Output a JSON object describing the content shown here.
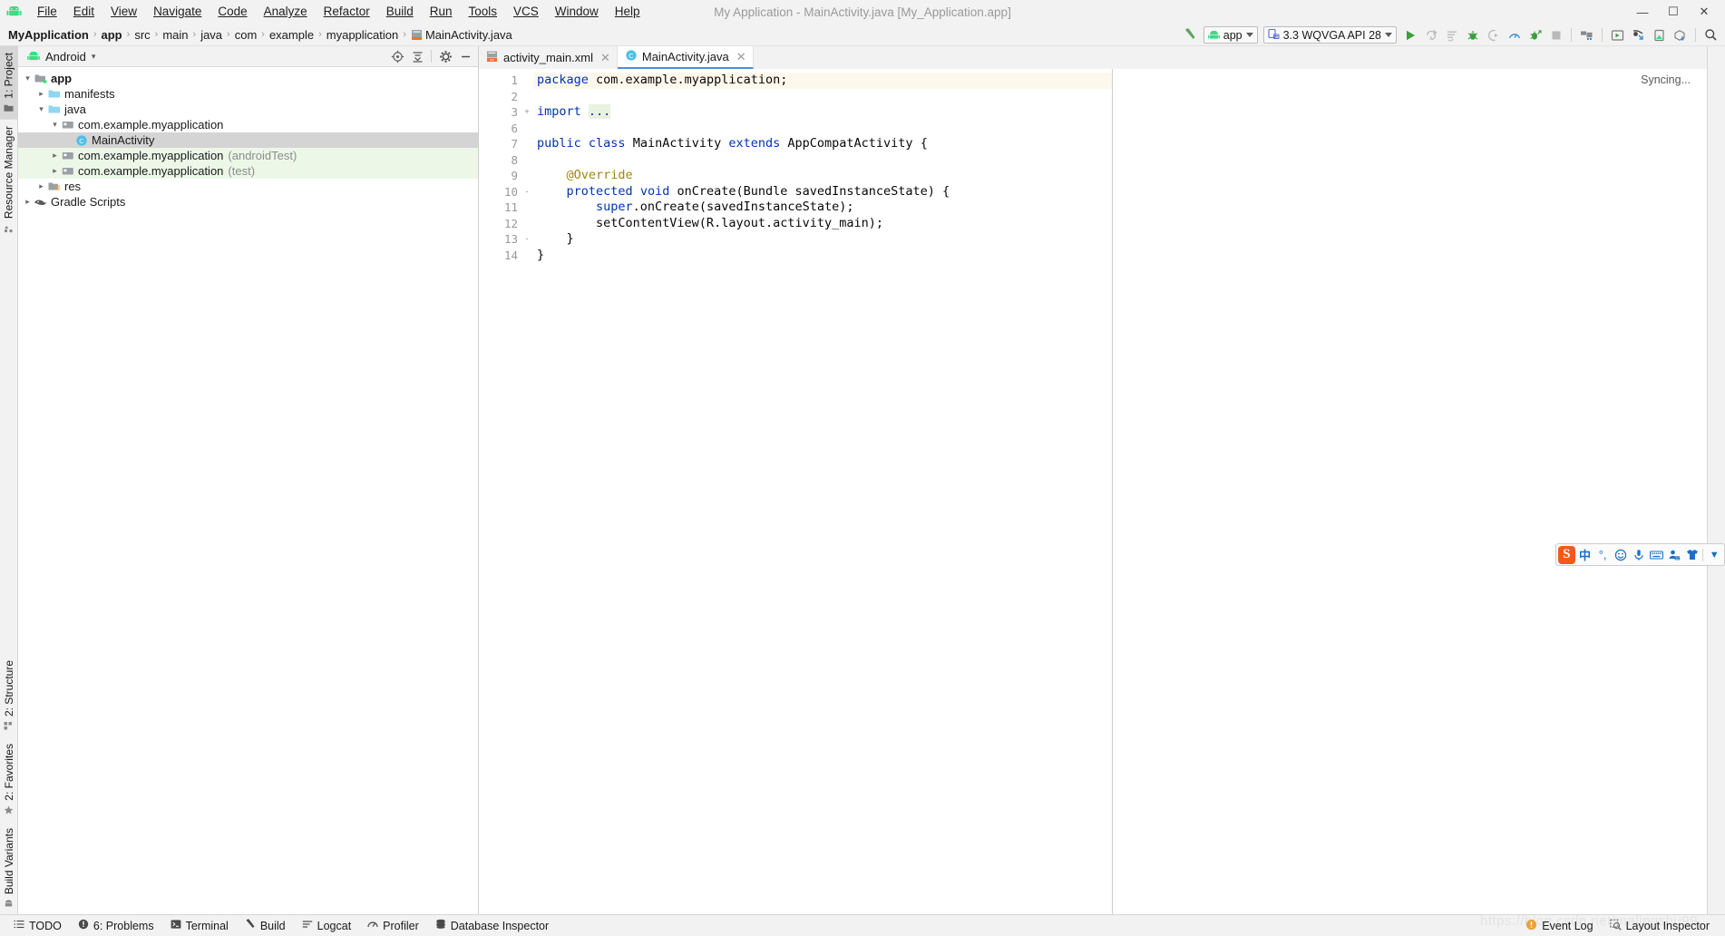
{
  "window": {
    "title": "My Application - MainActivity.java [My_Application.app]",
    "minimize": "—",
    "maximize": "☐",
    "close": "✕"
  },
  "menu": {
    "logo_icon": "android-logo-icon",
    "items": [
      {
        "label": "File"
      },
      {
        "label": "Edit"
      },
      {
        "label": "View"
      },
      {
        "label": "Navigate"
      },
      {
        "label": "Code"
      },
      {
        "label": "Analyze"
      },
      {
        "label": "Refactor"
      },
      {
        "label": "Build"
      },
      {
        "label": "Run"
      },
      {
        "label": "Tools"
      },
      {
        "label": "VCS"
      },
      {
        "label": "Window"
      },
      {
        "label": "Help"
      }
    ]
  },
  "breadcrumb": {
    "separator": "›",
    "items": [
      {
        "label": "MyApplication",
        "bold": true
      },
      {
        "label": "app",
        "bold": true
      },
      {
        "label": "src",
        "bold": false
      },
      {
        "label": "main",
        "bold": false
      },
      {
        "label": "java",
        "bold": false
      },
      {
        "label": "com",
        "bold": false
      },
      {
        "label": "example",
        "bold": false
      },
      {
        "label": "myapplication",
        "bold": false
      },
      {
        "label": "MainActivity.java",
        "bold": false,
        "icon": "java-file-icon"
      }
    ]
  },
  "toolbar": {
    "build_hammer_icon": "hammer-icon",
    "run_config": {
      "label": "app",
      "icon": "android-head-icon"
    },
    "device": {
      "label": "3.3  WQVGA API 28",
      "icon": "device-icon"
    },
    "actions": [
      {
        "name": "run-button",
        "icon": "play-icon",
        "enabled": true
      },
      {
        "name": "apply-changes-button",
        "icon": "apply-changes-icon",
        "enabled": false
      },
      {
        "name": "apply-code-changes-button",
        "icon": "apply-code-changes-icon",
        "enabled": false
      },
      {
        "name": "debug-button",
        "icon": "bug-icon",
        "enabled": true
      },
      {
        "name": "attach-debugger-button",
        "icon": "attach-debugger-icon",
        "enabled": false
      },
      {
        "name": "profile-button",
        "icon": "profiler-icon",
        "enabled": true
      },
      {
        "name": "run-with-coverage-button",
        "icon": "coverage-icon",
        "enabled": true
      },
      {
        "name": "stop-button",
        "icon": "stop-icon",
        "enabled": false
      }
    ],
    "actions2": [
      {
        "name": "sdk-manager-button",
        "icon": "sdk-manager-icon"
      },
      {
        "name": "avd-manager-button",
        "icon": "avd-manager-icon"
      },
      {
        "name": "device-file-explorer-button",
        "icon": "device-explorer-icon"
      },
      {
        "name": "layout-inspector-button",
        "icon": "layout-inspector-icon"
      },
      {
        "name": "gradle-sync-button",
        "icon": "gradle-sync-icon"
      },
      {
        "name": "search-everywhere-button",
        "icon": "search-icon"
      }
    ]
  },
  "left_strip": {
    "top": [
      {
        "label": "1: Project",
        "icon": "project-icon",
        "active": true
      },
      {
        "label": "Resource Manager",
        "icon": "resource-manager-icon",
        "active": false
      }
    ],
    "bottom": [
      {
        "label": "2: Structure",
        "icon": "structure-icon"
      },
      {
        "label": "2: Favorites",
        "icon": "star-icon"
      },
      {
        "label": "Build Variants",
        "icon": "build-variants-icon"
      }
    ]
  },
  "project_panel": {
    "title": "Android",
    "title_icon": "android-head-icon",
    "title_caret": "▾",
    "actions": [
      {
        "name": "select-opened-file-button",
        "icon": "target-icon"
      },
      {
        "name": "collapse-all-button",
        "icon": "collapse-all-icon"
      },
      {
        "name": "settings-button",
        "icon": "gear-icon"
      },
      {
        "name": "hide-button",
        "icon": "minimize-icon"
      }
    ],
    "tree": [
      {
        "label": "app",
        "suffix": "",
        "depth": 0,
        "arrow": "expanded",
        "icon": "module-icon",
        "bold": true,
        "state": "normal"
      },
      {
        "label": "manifests",
        "suffix": "",
        "depth": 1,
        "arrow": "collapsed",
        "icon": "folder-icon",
        "bold": false,
        "state": "normal"
      },
      {
        "label": "java",
        "suffix": "",
        "depth": 1,
        "arrow": "expanded",
        "icon": "folder-icon",
        "bold": false,
        "state": "normal"
      },
      {
        "label": "com.example.myapplication",
        "suffix": "",
        "depth": 2,
        "arrow": "expanded",
        "icon": "package-icon",
        "bold": false,
        "state": "normal"
      },
      {
        "label": "MainActivity",
        "suffix": "",
        "depth": 3,
        "arrow": "none",
        "icon": "class-icon",
        "bold": false,
        "state": "selected"
      },
      {
        "label": "com.example.myapplication",
        "suffix": "(androidTest)",
        "depth": 2,
        "arrow": "collapsed",
        "icon": "package-icon",
        "bold": false,
        "state": "green"
      },
      {
        "label": "com.example.myapplication",
        "suffix": "(test)",
        "depth": 2,
        "arrow": "collapsed",
        "icon": "package-icon",
        "bold": false,
        "state": "green"
      },
      {
        "label": "res",
        "suffix": "",
        "depth": 1,
        "arrow": "collapsed",
        "icon": "res-folder-icon",
        "bold": false,
        "state": "normal"
      },
      {
        "label": "Gradle Scripts",
        "suffix": "",
        "depth": 0,
        "arrow": "collapsed",
        "icon": "gradle-icon",
        "bold": false,
        "state": "normal"
      }
    ]
  },
  "editor": {
    "tabs": [
      {
        "label": "activity_main.xml",
        "icon": "xml-layout-icon",
        "active": false,
        "close": "✕"
      },
      {
        "label": "MainActivity.java",
        "icon": "class-icon",
        "active": true,
        "close": "✕"
      }
    ],
    "status_right": "Syncing...",
    "line_numbers": [
      "1",
      "2",
      "3",
      "6",
      "7",
      "8",
      "9",
      "10",
      "11",
      "12",
      "13",
      "14"
    ],
    "fold_marks": [
      "",
      "",
      "+",
      "",
      "",
      "",
      "",
      "-",
      "",
      "",
      "-",
      ""
    ],
    "lines": [
      {
        "num": "1",
        "highlight": true,
        "tokens": [
          {
            "t": "kw",
            "v": "package"
          },
          {
            "t": "plain",
            "v": " com.example.myapplication;"
          }
        ]
      },
      {
        "num": "2",
        "highlight": false,
        "tokens": []
      },
      {
        "num": "3",
        "highlight": false,
        "tokens": [
          {
            "t": "kw",
            "v": "import"
          },
          {
            "t": "plain",
            "v": " "
          },
          {
            "t": "fold",
            "v": "..."
          }
        ]
      },
      {
        "num": "6",
        "highlight": false,
        "tokens": []
      },
      {
        "num": "7",
        "highlight": false,
        "tokens": [
          {
            "t": "kw",
            "v": "public"
          },
          {
            "t": "plain",
            "v": " "
          },
          {
            "t": "kw",
            "v": "class"
          },
          {
            "t": "plain",
            "v": " MainActivity "
          },
          {
            "t": "kw",
            "v": "extends"
          },
          {
            "t": "plain",
            "v": " AppCompatActivity {"
          }
        ]
      },
      {
        "num": "8",
        "highlight": false,
        "tokens": []
      },
      {
        "num": "9",
        "highlight": false,
        "tokens": [
          {
            "t": "plain",
            "v": "    "
          },
          {
            "t": "an",
            "v": "@Override"
          }
        ]
      },
      {
        "num": "10",
        "highlight": false,
        "tokens": [
          {
            "t": "plain",
            "v": "    "
          },
          {
            "t": "kw",
            "v": "protected"
          },
          {
            "t": "plain",
            "v": " "
          },
          {
            "t": "kw",
            "v": "void"
          },
          {
            "t": "plain",
            "v": " onCreate(Bundle savedInstanceState) {"
          }
        ]
      },
      {
        "num": "11",
        "highlight": false,
        "tokens": [
          {
            "t": "plain",
            "v": "        "
          },
          {
            "t": "kw",
            "v": "super"
          },
          {
            "t": "plain",
            "v": ".onCreate(savedInstanceState);"
          }
        ]
      },
      {
        "num": "12",
        "highlight": false,
        "tokens": [
          {
            "t": "plain",
            "v": "        setContentView(R.layout.activity_main);"
          }
        ]
      },
      {
        "num": "13",
        "highlight": false,
        "tokens": [
          {
            "t": "plain",
            "v": "    }"
          }
        ]
      },
      {
        "num": "14",
        "highlight": false,
        "tokens": [
          {
            "t": "plain",
            "v": "}"
          }
        ]
      }
    ]
  },
  "statusbar": {
    "left_items": [
      {
        "label": "TODO",
        "icon": "todo-icon"
      },
      {
        "label": "6: Problems",
        "icon": "problems-icon"
      },
      {
        "label": "Terminal",
        "icon": "terminal-icon"
      },
      {
        "label": "Build",
        "icon": "hammer-icon"
      },
      {
        "label": "Logcat",
        "icon": "logcat-icon"
      },
      {
        "label": "Profiler",
        "icon": "profiler-icon"
      },
      {
        "label": "Database Inspector",
        "icon": "database-icon"
      }
    ],
    "right_items": [
      {
        "label": "Event Log",
        "icon": "event-log-icon"
      },
      {
        "label": "Layout Inspector",
        "icon": "layout-inspector-icon"
      }
    ],
    "watermark": "https://blog.csdn.net/malingshu99"
  },
  "ime": {
    "logo": "S",
    "items": [
      {
        "name": "ime-mode-chinese",
        "glyph": "中"
      },
      {
        "name": "ime-punctuation-toggle",
        "glyph": "°,"
      },
      {
        "name": "ime-emoji-icon",
        "glyph": "☺"
      },
      {
        "name": "ime-voice-input-icon",
        "glyph": "Ἲ4"
      },
      {
        "name": "ime-keyboard-icon",
        "glyph": "⌨"
      },
      {
        "name": "ime-user-icon",
        "glyph": "22"
      },
      {
        "name": "ime-skin-icon",
        "glyph": "T"
      },
      {
        "name": "ime-menu-icon",
        "glyph": "⋮"
      }
    ]
  },
  "colors": {
    "accent": "#4a90d9",
    "android_green": "#3ddc84",
    "keyword": "#0033b3",
    "annotation": "#9e880d",
    "selection": "#d4d4d4",
    "test_row": "#edf7e8",
    "caret_row": "#fdf8ec"
  }
}
